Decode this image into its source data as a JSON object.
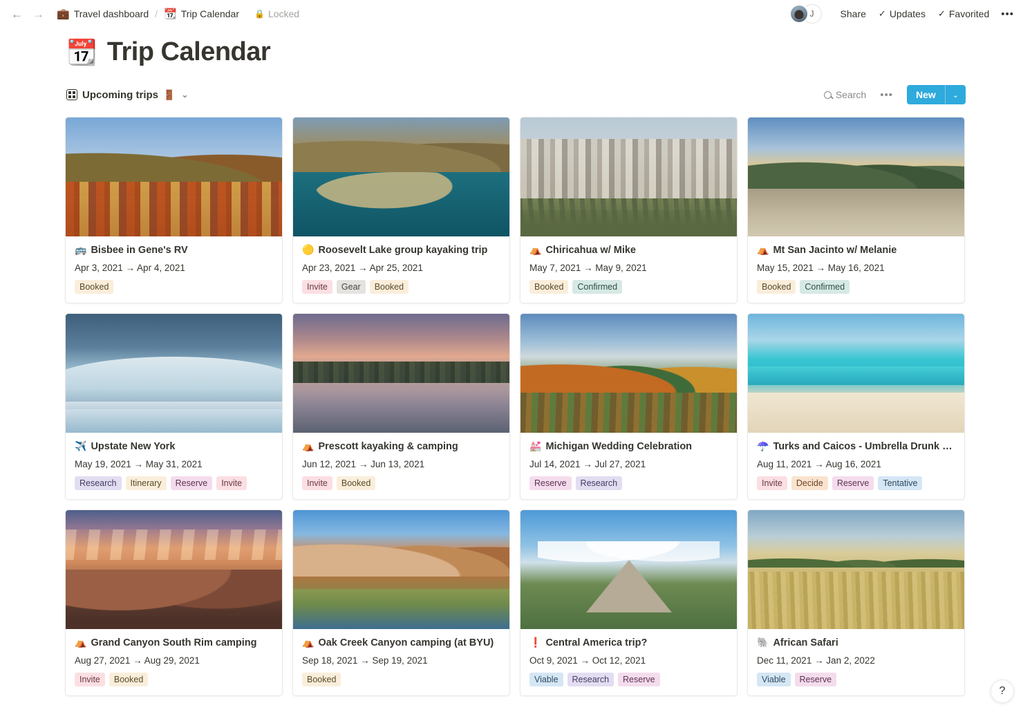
{
  "topbar": {
    "back_icon": "arrow-left-icon",
    "forward_icon": "arrow-right-icon",
    "breadcrumb": [
      {
        "emoji": "💼",
        "label": "Travel dashboard"
      },
      {
        "emoji": "📆",
        "label": "Trip Calendar"
      }
    ],
    "separator": "/",
    "locked_label": "Locked",
    "lock_icon": "🔒",
    "avatar_initial": "J",
    "actions": [
      {
        "label": "Share",
        "check": false
      },
      {
        "label": "Updates",
        "check": true
      },
      {
        "label": "Favorited",
        "check": true
      }
    ],
    "more_label": "•••"
  },
  "page": {
    "emoji": "📆",
    "title": "Trip Calendar"
  },
  "view": {
    "name": "Upcoming trips",
    "badge": "🚪",
    "chevron": "⌄",
    "search_label": "Search",
    "more_label": "•••",
    "new_label": "New",
    "new_chevron": "⌄"
  },
  "help": {
    "label": "?"
  },
  "tag_colors": {
    "Booked": {
      "bg": "#faeedb",
      "fg": "#5b4a28"
    },
    "Invite": {
      "bg": "#fbdfe3",
      "fg": "#6b3a42"
    },
    "Gear": {
      "bg": "#e4e3e0",
      "fg": "#46443f"
    },
    "Confirmed": {
      "bg": "#d7e9e4",
      "fg": "#2e4e47"
    },
    "Research": {
      "bg": "#e3ddf2",
      "fg": "#453b63"
    },
    "Itinerary": {
      "bg": "#faeedb",
      "fg": "#5b4a28"
    },
    "Reserve": {
      "bg": "#f4dced",
      "fg": "#5e3352"
    },
    "Decide": {
      "bg": "#fae3cf",
      "fg": "#6b4527"
    },
    "Tentative": {
      "bg": "#d5e6f4",
      "fg": "#2c4a61"
    },
    "Viable": {
      "bg": "#d5e6f4",
      "fg": "#2c4a61"
    }
  },
  "cards": [
    {
      "emoji": "🚌",
      "title": "Bisbee in Gene's RV",
      "date": "Apr 3, 2021 → Apr 4, 2021",
      "tags": [
        "Booked"
      ],
      "scene": "sc1"
    },
    {
      "emoji": "🟡",
      "title": "Roosevelt Lake group kayaking trip",
      "date": "Apr 23, 2021 → Apr 25, 2021",
      "tags": [
        "Invite",
        "Gear",
        "Booked"
      ],
      "scene": "sc2"
    },
    {
      "emoji": "⛺",
      "title": "Chiricahua w/ Mike",
      "date": "May 7, 2021 → May 9, 2021",
      "tags": [
        "Booked",
        "Confirmed"
      ],
      "scene": "sc3"
    },
    {
      "emoji": "⛺",
      "title": "Mt San Jacinto w/ Melanie",
      "date": "May 15, 2021 → May 16, 2021",
      "tags": [
        "Booked",
        "Confirmed"
      ],
      "scene": "sc4"
    },
    {
      "emoji": "✈️",
      "title": "Upstate New York",
      "date": "May 19, 2021 → May 31, 2021",
      "tags": [
        "Research",
        "Itinerary",
        "Reserve",
        "Invite"
      ],
      "scene": "sc5"
    },
    {
      "emoji": "⛺",
      "title": "Prescott kayaking & camping",
      "date": "Jun 12, 2021 → Jun 13, 2021",
      "tags": [
        "Invite",
        "Booked"
      ],
      "scene": "sc6"
    },
    {
      "emoji": "💒",
      "title": "Michigan Wedding Celebration",
      "date": "Jul 14, 2021 → Jul 27, 2021",
      "tags": [
        "Reserve",
        "Research"
      ],
      "scene": "sc7"
    },
    {
      "emoji": "☂️",
      "title": "Turks and Caicos - Umbrella Drunk Cel...",
      "date": "Aug 11, 2021 → Aug 16, 2021",
      "tags": [
        "Invite",
        "Decide",
        "Reserve",
        "Tentative"
      ],
      "scene": "sc8"
    },
    {
      "emoji": "⛺",
      "title": "Grand Canyon South Rim camping",
      "date": "Aug 27, 2021 → Aug 29, 2021",
      "tags": [
        "Invite",
        "Booked"
      ],
      "scene": "sc9"
    },
    {
      "emoji": "⛺",
      "title": "Oak Creek Canyon camping (at BYU)",
      "date": "Sep 18, 2021 → Sep 19, 2021",
      "tags": [
        "Booked"
      ],
      "scene": "sc10"
    },
    {
      "emoji": "❗",
      "title": "Central America trip?",
      "date": "Oct 9, 2021 → Oct 12, 2021",
      "tags": [
        "Viable",
        "Research",
        "Reserve"
      ],
      "scene": "sc11"
    },
    {
      "emoji": "🐘",
      "title": "African Safari",
      "date": "Dec 11, 2021 → Jan 2, 2022",
      "tags": [
        "Viable",
        "Reserve"
      ],
      "scene": "sc12"
    }
  ]
}
